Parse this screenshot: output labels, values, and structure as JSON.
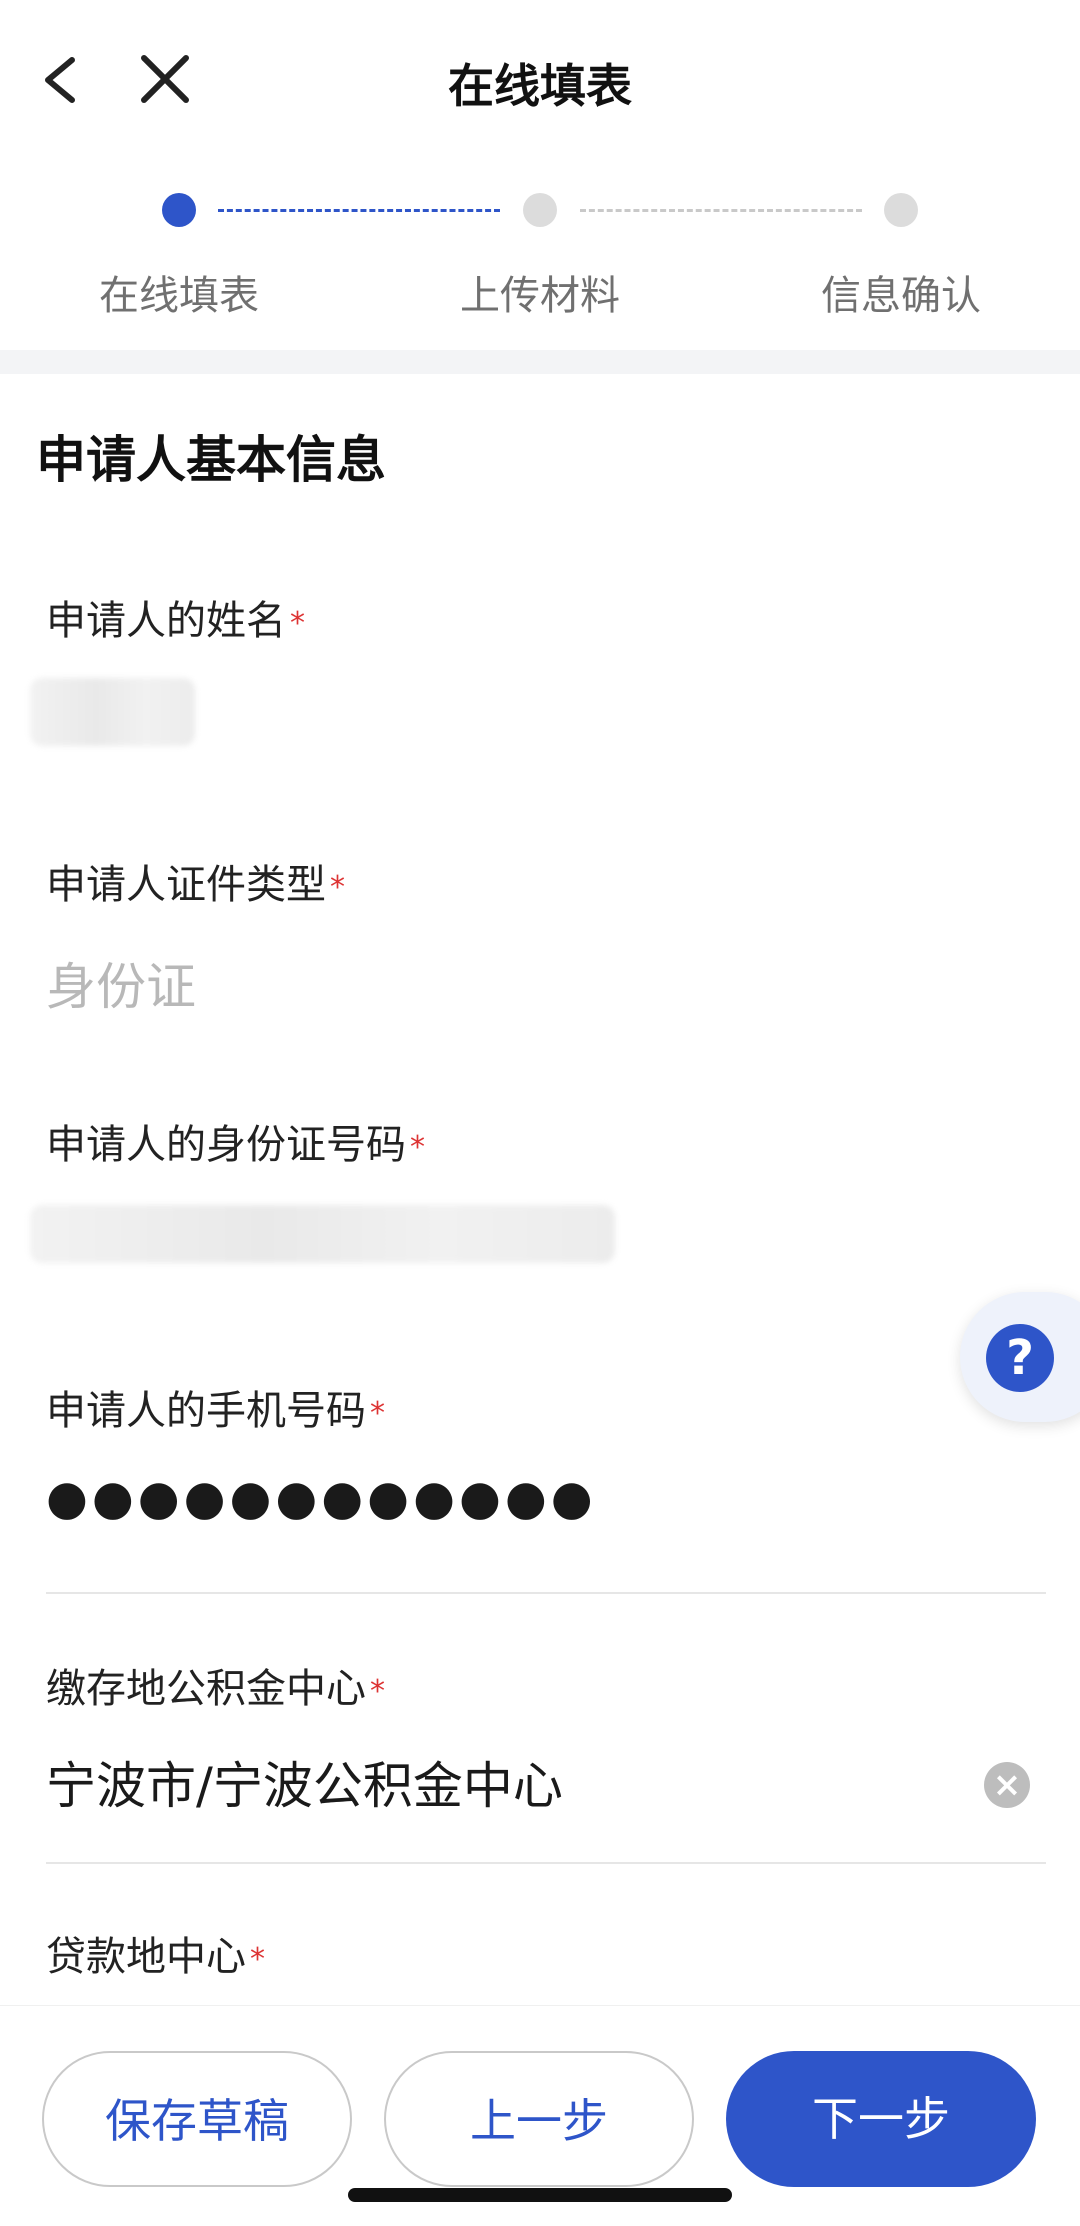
{
  "header": {
    "title": "在线填表"
  },
  "steps": [
    {
      "label": "在线填表"
    },
    {
      "label": "上传材料"
    },
    {
      "label": "信息确认"
    }
  ],
  "section": {
    "title": "申请人基本信息"
  },
  "fields": {
    "name": {
      "label": "申请人的姓名",
      "required": "*"
    },
    "id_type": {
      "label": "申请人证件类型",
      "required": "*",
      "value": "身份证"
    },
    "id_number": {
      "label": "申请人的身份证号码",
      "required": "*"
    },
    "phone": {
      "label": "申请人的手机号码",
      "required": "*",
      "value": "●●●●●●●●●●●●"
    },
    "deposit_center": {
      "label": "缴存地公积金中心",
      "required": "*",
      "value": "宁波市/宁波公积金中心"
    },
    "loan_center": {
      "label": "贷款地中心",
      "required": "*"
    }
  },
  "help": {
    "symbol": "?"
  },
  "clear": {
    "symbol": "×"
  },
  "buttons": {
    "save_draft": "保存草稿",
    "prev": "上一步",
    "next": "下一步"
  },
  "colors": {
    "accent": "#2e55c9",
    "required": "#d33333",
    "placeholder": "#b8b8b8"
  }
}
